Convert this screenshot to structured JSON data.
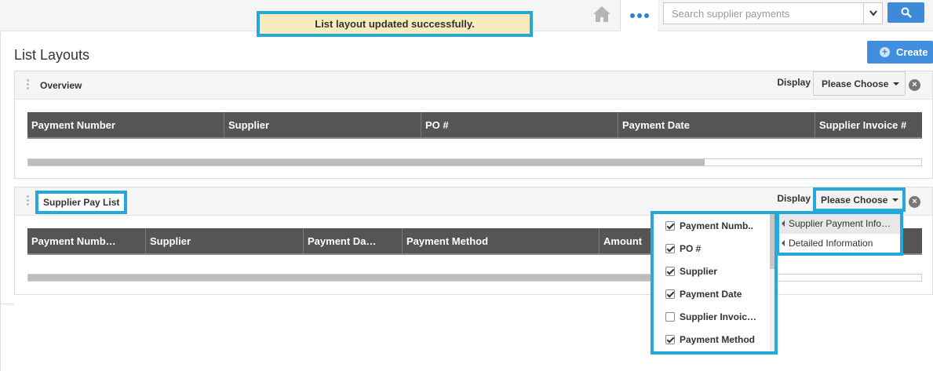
{
  "toast": {
    "message": "List layout updated successfully."
  },
  "topbar": {
    "search_placeholder": "Search supplier payments"
  },
  "page": {
    "title": "List Layouts",
    "create_label": "Create"
  },
  "panels": [
    {
      "name": "Overview",
      "display_label": "Display",
      "choose_label": "Please Choose",
      "columns": [
        "Payment Number",
        "Supplier",
        "PO #",
        "Payment Date",
        "Supplier Invoice #"
      ]
    },
    {
      "name": "Supplier Pay List",
      "display_label": "Display",
      "choose_label": "Please Choose",
      "columns": [
        "Payment Numb…",
        "Supplier",
        "Payment Da…",
        "Payment Method",
        "Amount"
      ]
    }
  ],
  "column_menu": [
    {
      "label": "Payment Numb..",
      "checked": true
    },
    {
      "label": "PO #",
      "checked": true
    },
    {
      "label": "Supplier",
      "checked": true
    },
    {
      "label": "Payment Date",
      "checked": true
    },
    {
      "label": "Supplier Invoic…",
      "checked": false
    },
    {
      "label": "Payment Method",
      "checked": true
    }
  ],
  "display_menu": [
    "Supplier Payment Info…",
    "Detailed Information"
  ],
  "colors": {
    "accent": "#23a9dc",
    "toast_bg": "#f8ebbc",
    "button_blue": "#3f8ee0",
    "header_grey": "#555555"
  }
}
